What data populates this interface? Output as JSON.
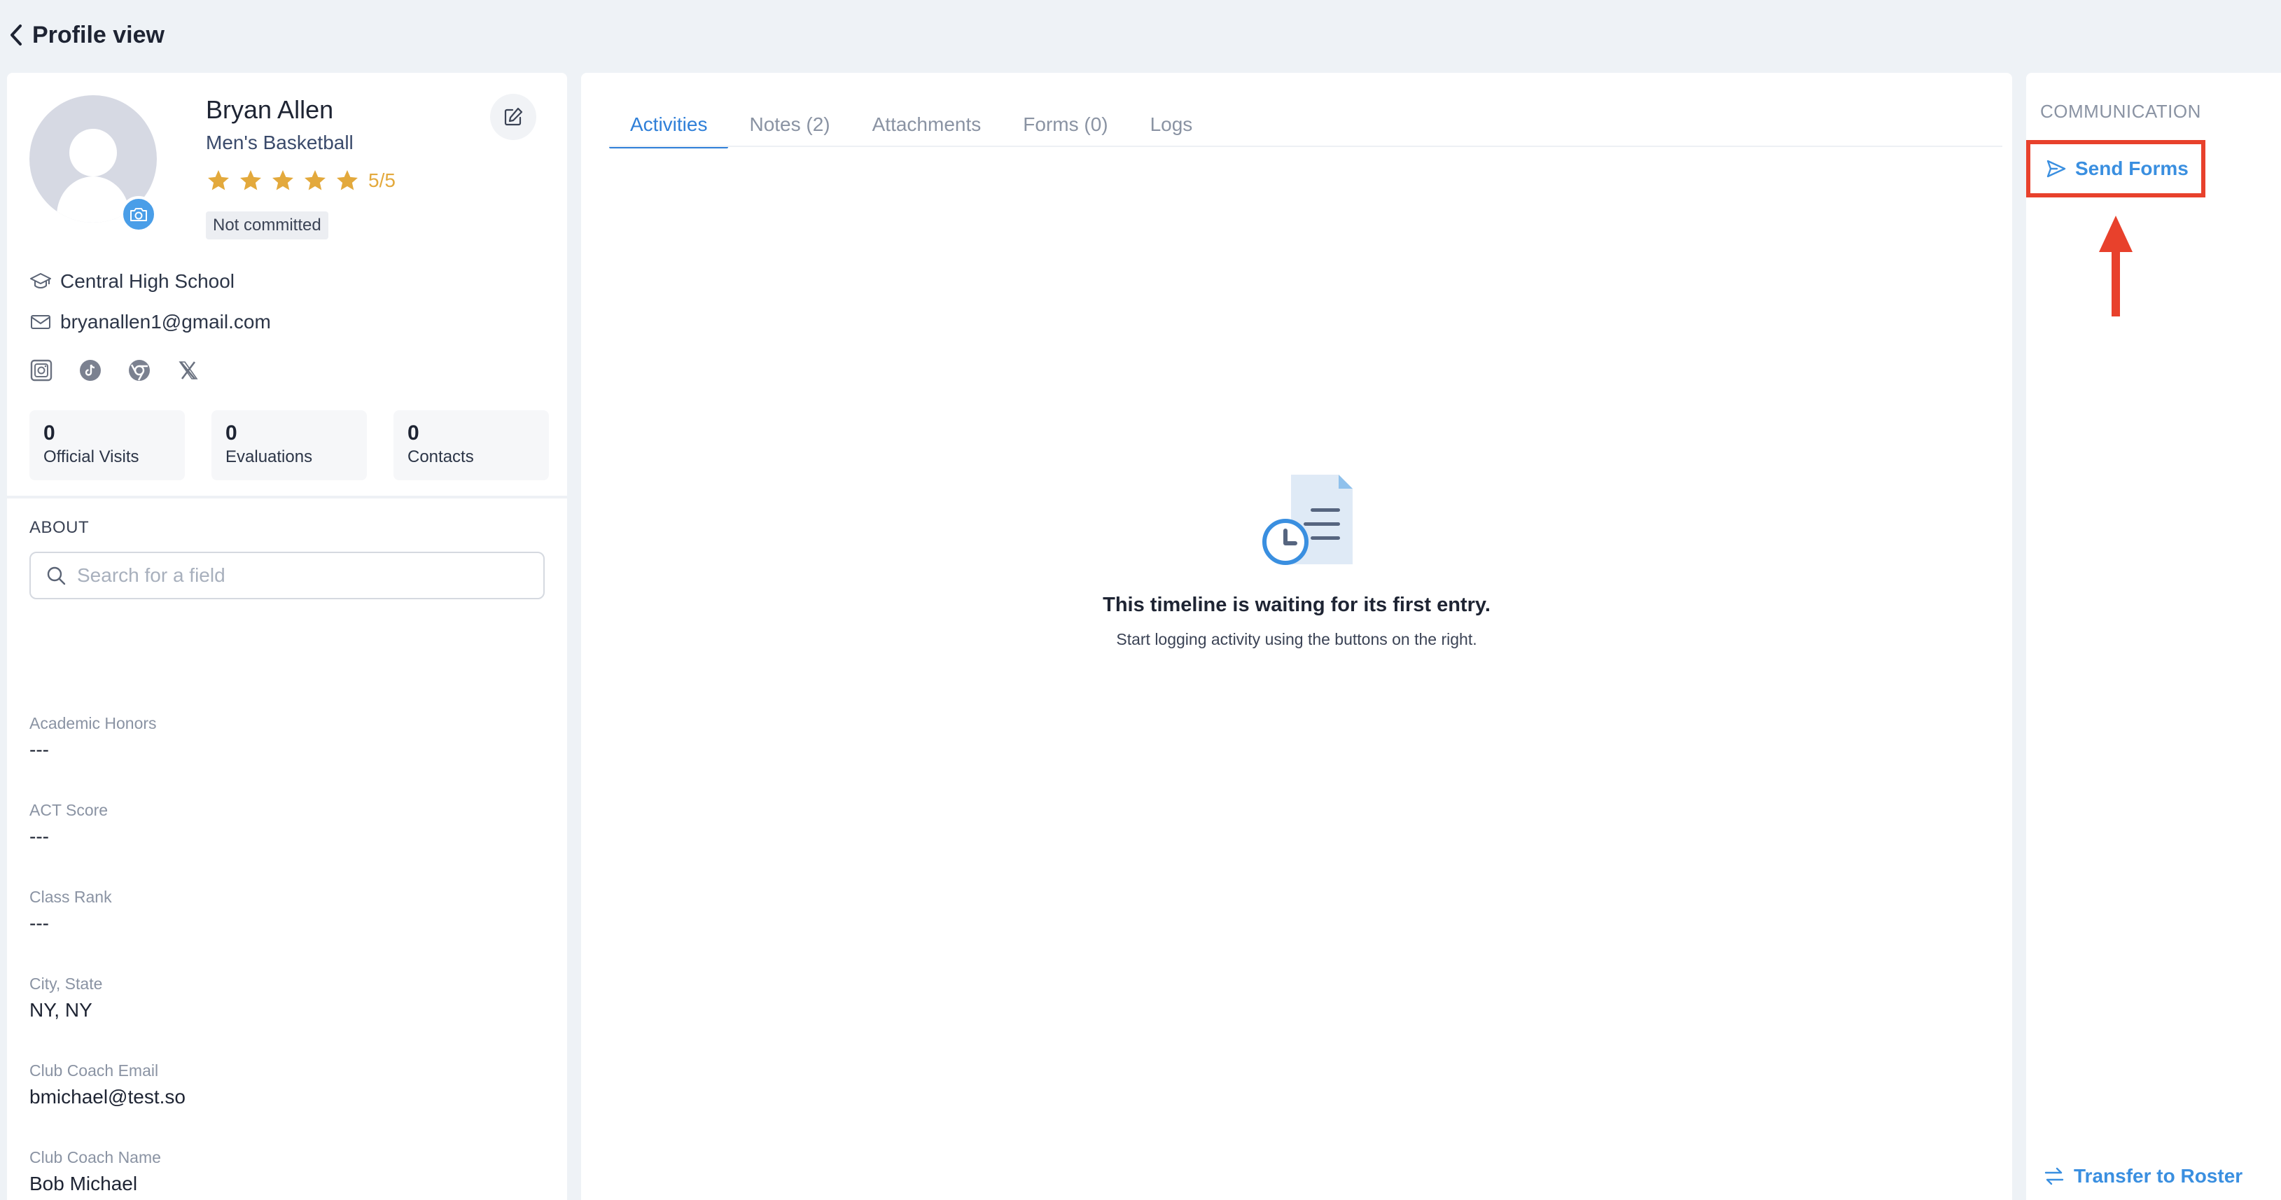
{
  "header": {
    "title": "Profile view"
  },
  "profile": {
    "name": "Bryan Allen",
    "sport": "Men's Basketball",
    "rating": "5/5",
    "rating_value": 5,
    "rating_max": 5,
    "commit_status": "Not committed",
    "school": "Central High School",
    "email": "bryanallen1@gmail.com",
    "socials": [
      "instagram-icon",
      "tiktok-icon",
      "chrome-icon",
      "x-icon"
    ]
  },
  "stats": [
    {
      "value": "0",
      "label": "Official Visits"
    },
    {
      "value": "0",
      "label": "Evaluations"
    },
    {
      "value": "0",
      "label": "Contacts"
    }
  ],
  "about": {
    "label": "ABOUT",
    "search_placeholder": "Search for a field",
    "fields": [
      {
        "label": "Academic Honors",
        "value": "---"
      },
      {
        "label": "ACT Score",
        "value": "---"
      },
      {
        "label": "Class Rank",
        "value": "---"
      },
      {
        "label": "City, State",
        "value": "NY, NY"
      },
      {
        "label": "Club Coach Email",
        "value": "bmichael@test.so"
      },
      {
        "label": "Club Coach Name",
        "value": "Bob Michael"
      }
    ]
  },
  "tabs": [
    {
      "label": "Activities",
      "active": true
    },
    {
      "label": "Notes (2)",
      "active": false
    },
    {
      "label": "Attachments",
      "active": false
    },
    {
      "label": "Forms (0)",
      "active": false
    },
    {
      "label": "Logs",
      "active": false
    }
  ],
  "empty_state": {
    "title": "This timeline is waiting for its first entry.",
    "subtitle": "Start logging activity using the buttons on the right."
  },
  "communication": {
    "label": "COMMUNICATION",
    "send_forms": "Send Forms",
    "transfer": "Transfer to Roster"
  },
  "colors": {
    "accent": "#2f7fd8",
    "star": "#e3a93c",
    "highlight": "#e8412c",
    "background": "#eef2f6"
  }
}
